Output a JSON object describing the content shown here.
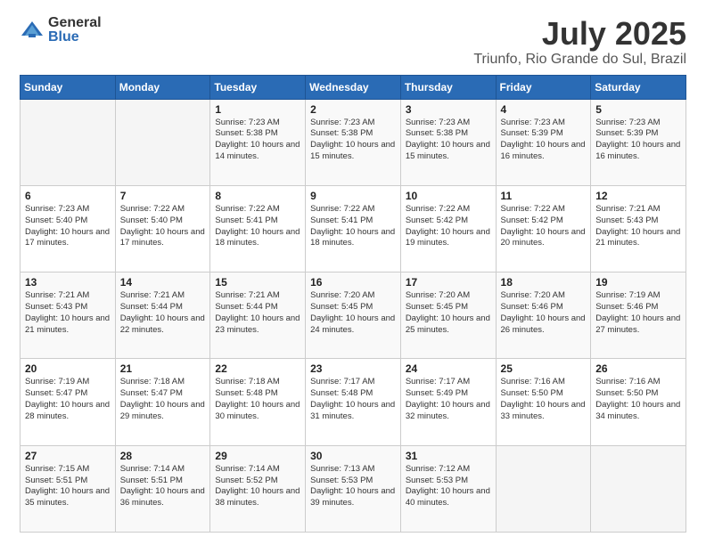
{
  "logo": {
    "general": "General",
    "blue": "Blue"
  },
  "title": {
    "month": "July 2025",
    "location": "Triunfo, Rio Grande do Sul, Brazil"
  },
  "weekdays": [
    "Sunday",
    "Monday",
    "Tuesday",
    "Wednesday",
    "Thursday",
    "Friday",
    "Saturday"
  ],
  "weeks": [
    [
      {
        "day": "",
        "info": ""
      },
      {
        "day": "",
        "info": ""
      },
      {
        "day": "1",
        "info": "Sunrise: 7:23 AM\nSunset: 5:38 PM\nDaylight: 10 hours and 14 minutes."
      },
      {
        "day": "2",
        "info": "Sunrise: 7:23 AM\nSunset: 5:38 PM\nDaylight: 10 hours and 15 minutes."
      },
      {
        "day": "3",
        "info": "Sunrise: 7:23 AM\nSunset: 5:38 PM\nDaylight: 10 hours and 15 minutes."
      },
      {
        "day": "4",
        "info": "Sunrise: 7:23 AM\nSunset: 5:39 PM\nDaylight: 10 hours and 16 minutes."
      },
      {
        "day": "5",
        "info": "Sunrise: 7:23 AM\nSunset: 5:39 PM\nDaylight: 10 hours and 16 minutes."
      }
    ],
    [
      {
        "day": "6",
        "info": "Sunrise: 7:23 AM\nSunset: 5:40 PM\nDaylight: 10 hours and 17 minutes."
      },
      {
        "day": "7",
        "info": "Sunrise: 7:22 AM\nSunset: 5:40 PM\nDaylight: 10 hours and 17 minutes."
      },
      {
        "day": "8",
        "info": "Sunrise: 7:22 AM\nSunset: 5:41 PM\nDaylight: 10 hours and 18 minutes."
      },
      {
        "day": "9",
        "info": "Sunrise: 7:22 AM\nSunset: 5:41 PM\nDaylight: 10 hours and 18 minutes."
      },
      {
        "day": "10",
        "info": "Sunrise: 7:22 AM\nSunset: 5:42 PM\nDaylight: 10 hours and 19 minutes."
      },
      {
        "day": "11",
        "info": "Sunrise: 7:22 AM\nSunset: 5:42 PM\nDaylight: 10 hours and 20 minutes."
      },
      {
        "day": "12",
        "info": "Sunrise: 7:21 AM\nSunset: 5:43 PM\nDaylight: 10 hours and 21 minutes."
      }
    ],
    [
      {
        "day": "13",
        "info": "Sunrise: 7:21 AM\nSunset: 5:43 PM\nDaylight: 10 hours and 21 minutes."
      },
      {
        "day": "14",
        "info": "Sunrise: 7:21 AM\nSunset: 5:44 PM\nDaylight: 10 hours and 22 minutes."
      },
      {
        "day": "15",
        "info": "Sunrise: 7:21 AM\nSunset: 5:44 PM\nDaylight: 10 hours and 23 minutes."
      },
      {
        "day": "16",
        "info": "Sunrise: 7:20 AM\nSunset: 5:45 PM\nDaylight: 10 hours and 24 minutes."
      },
      {
        "day": "17",
        "info": "Sunrise: 7:20 AM\nSunset: 5:45 PM\nDaylight: 10 hours and 25 minutes."
      },
      {
        "day": "18",
        "info": "Sunrise: 7:20 AM\nSunset: 5:46 PM\nDaylight: 10 hours and 26 minutes."
      },
      {
        "day": "19",
        "info": "Sunrise: 7:19 AM\nSunset: 5:46 PM\nDaylight: 10 hours and 27 minutes."
      }
    ],
    [
      {
        "day": "20",
        "info": "Sunrise: 7:19 AM\nSunset: 5:47 PM\nDaylight: 10 hours and 28 minutes."
      },
      {
        "day": "21",
        "info": "Sunrise: 7:18 AM\nSunset: 5:47 PM\nDaylight: 10 hours and 29 minutes."
      },
      {
        "day": "22",
        "info": "Sunrise: 7:18 AM\nSunset: 5:48 PM\nDaylight: 10 hours and 30 minutes."
      },
      {
        "day": "23",
        "info": "Sunrise: 7:17 AM\nSunset: 5:48 PM\nDaylight: 10 hours and 31 minutes."
      },
      {
        "day": "24",
        "info": "Sunrise: 7:17 AM\nSunset: 5:49 PM\nDaylight: 10 hours and 32 minutes."
      },
      {
        "day": "25",
        "info": "Sunrise: 7:16 AM\nSunset: 5:50 PM\nDaylight: 10 hours and 33 minutes."
      },
      {
        "day": "26",
        "info": "Sunrise: 7:16 AM\nSunset: 5:50 PM\nDaylight: 10 hours and 34 minutes."
      }
    ],
    [
      {
        "day": "27",
        "info": "Sunrise: 7:15 AM\nSunset: 5:51 PM\nDaylight: 10 hours and 35 minutes."
      },
      {
        "day": "28",
        "info": "Sunrise: 7:14 AM\nSunset: 5:51 PM\nDaylight: 10 hours and 36 minutes."
      },
      {
        "day": "29",
        "info": "Sunrise: 7:14 AM\nSunset: 5:52 PM\nDaylight: 10 hours and 38 minutes."
      },
      {
        "day": "30",
        "info": "Sunrise: 7:13 AM\nSunset: 5:53 PM\nDaylight: 10 hours and 39 minutes."
      },
      {
        "day": "31",
        "info": "Sunrise: 7:12 AM\nSunset: 5:53 PM\nDaylight: 10 hours and 40 minutes."
      },
      {
        "day": "",
        "info": ""
      },
      {
        "day": "",
        "info": ""
      }
    ]
  ]
}
